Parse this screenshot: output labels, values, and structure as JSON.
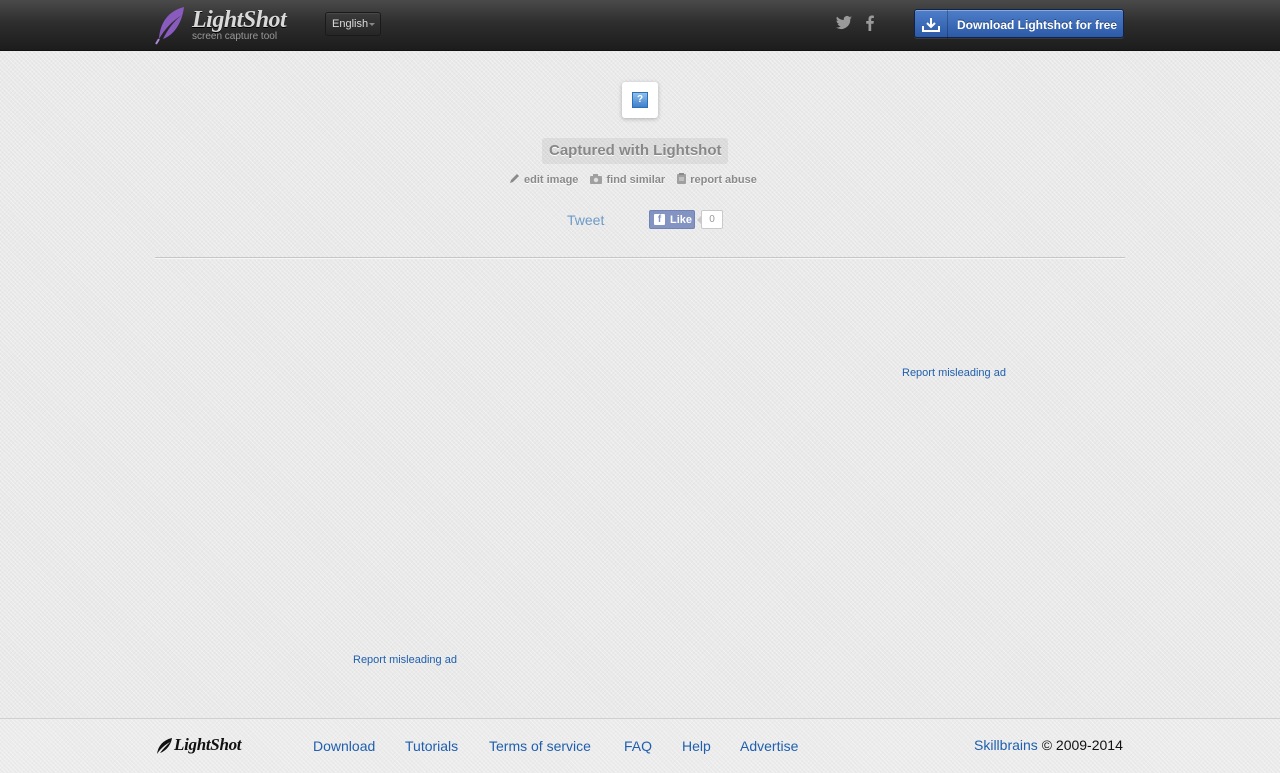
{
  "header": {
    "logo_name": "LightShot",
    "logo_tagline": "screen capture tool",
    "language": "English",
    "download_button": "Download Lightshot for free"
  },
  "main": {
    "caption": "Captured with Lightshot",
    "actions": {
      "edit": "edit image",
      "similar": "find similar",
      "report": "report abuse"
    },
    "tweet": "Tweet",
    "like_label": "Like",
    "like_count": "0",
    "ad_report_1": "Report misleading ad",
    "ad_report_2": "Report misleading ad"
  },
  "footer": {
    "logo_name": "LightShot",
    "nav": [
      "Download",
      "Tutorials",
      "Terms of service",
      "FAQ",
      "Help",
      "Advertise"
    ],
    "company": "Skillbrains",
    "copyright": "© 2009-2014"
  },
  "colors": {
    "link": "#1f5fae",
    "button": "#2c5aa7",
    "header": "#2e2e2e",
    "accent_logo": "#8a5bbf"
  }
}
